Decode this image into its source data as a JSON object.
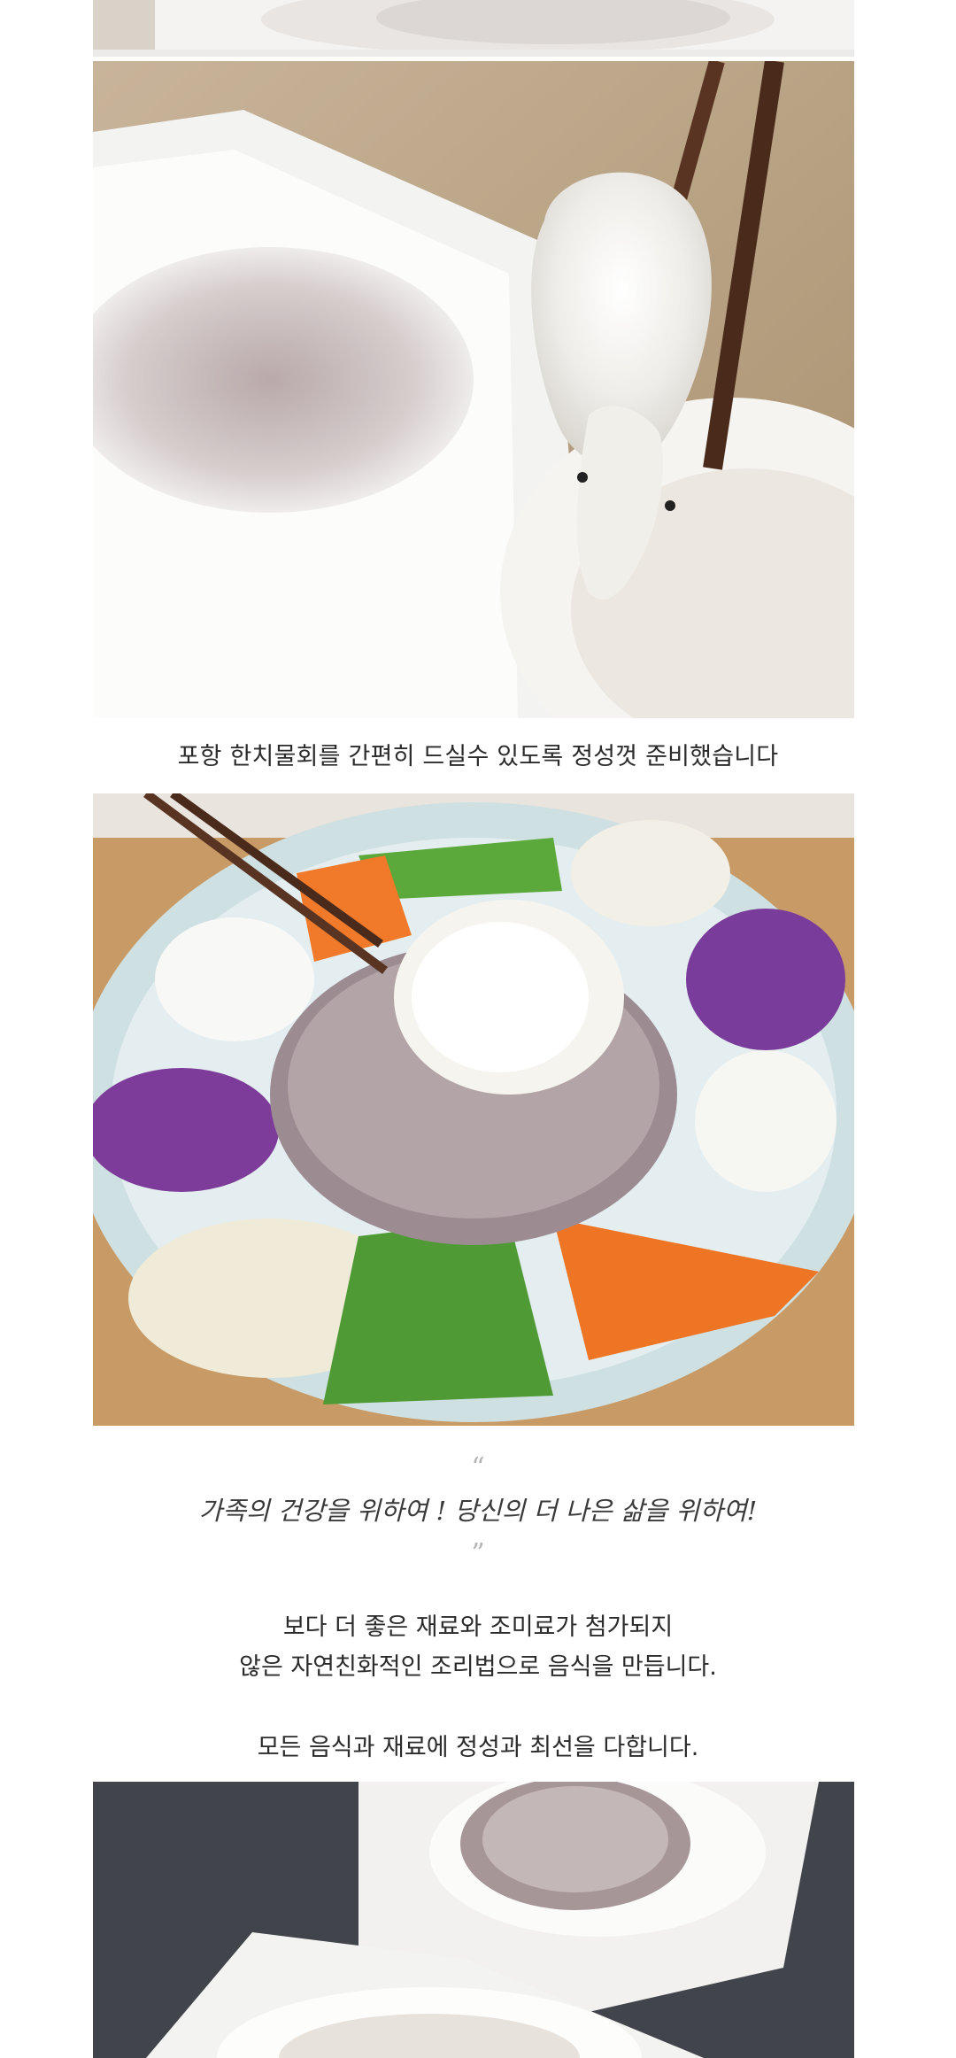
{
  "caption_1": "포항 한치물회를 간편히 드실수 있도록 정성껏 준비했습니다",
  "quote": {
    "open": "“",
    "text": "가족의 건강을 위하여 ! 당신의 더 나은 삶을 위하여!",
    "close": "”"
  },
  "body": {
    "line_1": "보다 더 좋은 재료와 조미료가 첨가되지",
    "line_2": "않은 자연친화적인 조리법으로 음식을 만듭니다.",
    "line_3": "모든 음식과 재료에 정성과 최선을 다합니다."
  },
  "images": {
    "top": "squid-sashimi-plate-crop",
    "chopsticks": "squid-held-by-chopsticks",
    "plate": "squid-sashimi-with-vegetables",
    "bottom": "squid-sashimi-dishes"
  }
}
